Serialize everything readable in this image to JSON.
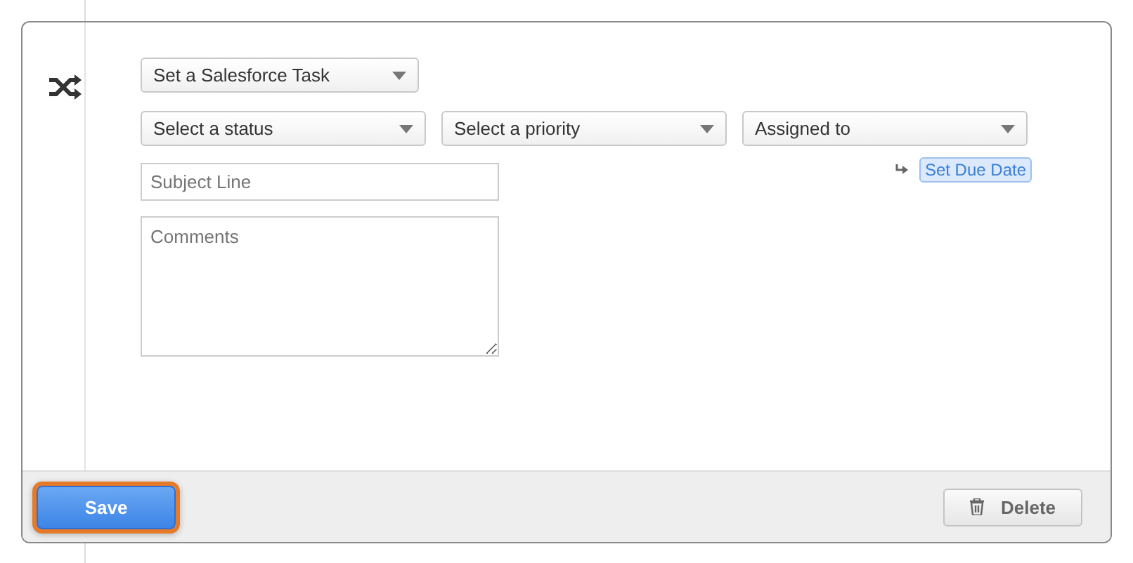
{
  "action": {
    "type_select": "Set a Salesforce Task",
    "selects": [
      {
        "label": "Select a status"
      },
      {
        "label": "Select a priority"
      },
      {
        "label": "Assigned to"
      }
    ],
    "due_date_link": "Set Due Date",
    "subject": {
      "placeholder": "Subject Line"
    },
    "comments": {
      "placeholder": "Comments"
    }
  },
  "footer": {
    "save": {
      "label": "Save",
      "highlighted": true
    },
    "delete": {
      "label": "Delete"
    }
  }
}
